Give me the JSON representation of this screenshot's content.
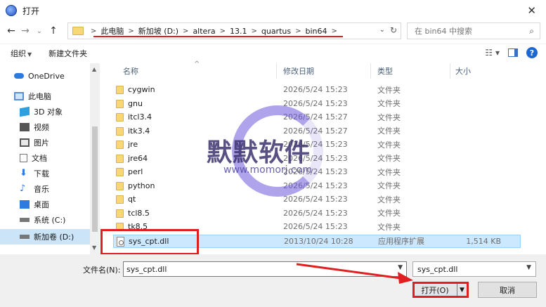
{
  "window": {
    "title": "打开",
    "close_symbol": "✕"
  },
  "nav": {
    "back": "←",
    "forward": "→",
    "recent": "⌄",
    "up": "↑"
  },
  "address": {
    "crumbs": [
      "此电脑",
      "新加坡 (D:)",
      "altera",
      "13.1",
      "quartus",
      "bin64"
    ],
    "separator": ">",
    "dropdown": "⌄",
    "refresh": "↻"
  },
  "search": {
    "placeholder": "在 bin64 中搜索",
    "icon": "search-icon"
  },
  "toolbar": {
    "organize": "组织",
    "new_folder": "新建文件夹",
    "view_icon": "view-menu-icon",
    "help": "?"
  },
  "sidebar": {
    "items": [
      {
        "label": "OneDrive",
        "icon": "cloud-icon",
        "color": "#2e7be0"
      },
      {
        "label": "此电脑",
        "icon": "computer-icon",
        "color": "#5a8fd6"
      },
      {
        "label": "3D 对象",
        "icon": "cube-icon",
        "color": "#2ea0e0"
      },
      {
        "label": "视频",
        "icon": "video-icon",
        "color": "#555555"
      },
      {
        "label": "图片",
        "icon": "picture-icon",
        "color": "#555555"
      },
      {
        "label": "文档",
        "icon": "document-icon",
        "color": "#777777"
      },
      {
        "label": "下载",
        "icon": "download-icon",
        "color": "#2e7be0"
      },
      {
        "label": "音乐",
        "icon": "music-icon",
        "color": "#2e7be0"
      },
      {
        "label": "桌面",
        "icon": "desktop-icon",
        "color": "#2e7be0"
      },
      {
        "label": "系统 (C:)",
        "icon": "drive-icon",
        "color": "#777777"
      },
      {
        "label": "新加卷 (D:)",
        "icon": "drive-icon",
        "color": "#777777"
      }
    ]
  },
  "columns": {
    "name": "名称",
    "modified": "修改日期",
    "type": "类型",
    "size": "大小"
  },
  "files": [
    {
      "name": "cygwin",
      "date": "2026/5/24 15:23",
      "type": "文件夹",
      "size": ""
    },
    {
      "name": "gnu",
      "date": "2026/5/24 15:23",
      "type": "文件夹",
      "size": ""
    },
    {
      "name": "itcl3.4",
      "date": "2026/5/24 15:27",
      "type": "文件夹",
      "size": ""
    },
    {
      "name": "itk3.4",
      "date": "2026/5/24 15:27",
      "type": "文件夹",
      "size": ""
    },
    {
      "name": "jre",
      "date": "2026/5/24 15:23",
      "type": "文件夹",
      "size": ""
    },
    {
      "name": "jre64",
      "date": "2026/5/24 15:23",
      "type": "文件夹",
      "size": ""
    },
    {
      "name": "perl",
      "date": "2026/5/24 15:23",
      "type": "文件夹",
      "size": ""
    },
    {
      "name": "python",
      "date": "2026/5/24 15:23",
      "type": "文件夹",
      "size": ""
    },
    {
      "name": "qt",
      "date": "2026/5/24 15:23",
      "type": "文件夹",
      "size": ""
    },
    {
      "name": "tcl8.5",
      "date": "2026/5/24 15:23",
      "type": "文件夹",
      "size": ""
    },
    {
      "name": "tk8.5",
      "date": "2026/5/24 15:23",
      "type": "文件夹",
      "size": ""
    },
    {
      "name": "sys_cpt.dll",
      "date": "2013/10/24 10:28",
      "type": "应用程序扩展",
      "size": "1,514 KB"
    }
  ],
  "watermark": {
    "text": "默默软件",
    "url": "www.momorj.com"
  },
  "footer": {
    "filename_label": "文件名(N):",
    "filename_value": "sys_cpt.dll",
    "filter_value": "sys_cpt.dll",
    "open_label": "打开(O)",
    "cancel_label": "取消"
  },
  "colors": {
    "accent": "#e02020",
    "selection": "#cce8ff",
    "link": "#1e66d0"
  }
}
